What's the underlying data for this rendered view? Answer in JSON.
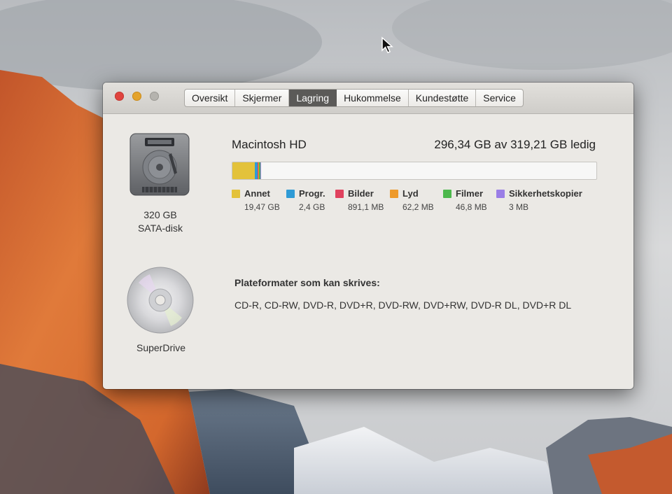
{
  "window": {
    "tabs": [
      {
        "label": "Oversikt"
      },
      {
        "label": "Skjermer"
      },
      {
        "label": "Lagring",
        "active": true
      },
      {
        "label": "Hukommelse"
      },
      {
        "label": "Kundestøtte"
      },
      {
        "label": "Service"
      }
    ]
  },
  "drives": {
    "hdd": {
      "size": "320 GB",
      "type": "SATA-disk",
      "icon": "hard-drive-icon"
    },
    "optical": {
      "label": "SuperDrive",
      "icon": "optical-disc-icon"
    }
  },
  "storage": {
    "name": "Macintosh HD",
    "free_text": "296,34 GB av 319,21 GB ledig",
    "segments": [
      {
        "label": "Annet",
        "value": "19,47 GB",
        "gb": 19.47,
        "color": "#e3c23a"
      },
      {
        "label": "Progr.",
        "value": "2,4 GB",
        "gb": 2.4,
        "color": "#2f9bd6"
      },
      {
        "label": "Bilder",
        "value": "891,1 MB",
        "gb": 0.891,
        "color": "#e0425e"
      },
      {
        "label": "Lyd",
        "value": "62,2 MB",
        "gb": 0.0622,
        "color": "#ee9a2a"
      },
      {
        "label": "Filmer",
        "value": "46,8 MB",
        "gb": 0.0468,
        "color": "#4cb84c"
      },
      {
        "label": "Sikkerhetskopier",
        "value": "3 MB",
        "gb": 0.003,
        "color": "#9a7ee6"
      }
    ],
    "total_gb": 319.21
  },
  "formats": {
    "title": "Plateformater som kan skrives:",
    "list": "CD-R, CD-RW, DVD-R, DVD+R, DVD-RW, DVD+RW, DVD-R DL, DVD+R DL"
  }
}
